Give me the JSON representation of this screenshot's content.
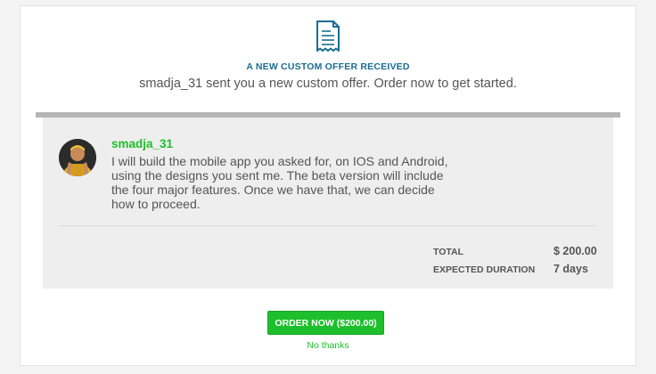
{
  "header": {
    "icon": "receipt-icon",
    "title": "A NEW CUSTOM OFFER RECEIVED",
    "subtitle": "smadja_31 sent you a new custom offer. Order now to get started."
  },
  "offer": {
    "seller_name": "smadja_31",
    "description": "I will build the mobile app you asked for, on IOS and Android, using the designs you sent me. The beta version will include the four major features. Once we have that, we can decide how to proceed.",
    "summary": [
      {
        "label": "TOTAL",
        "value": "$ 200.00"
      },
      {
        "label": "EXPECTED DURATION",
        "value": "7 days"
      }
    ]
  },
  "actions": {
    "order_label": "ORDER NOW ($200.00)",
    "decline_label": "No thanks"
  },
  "colors": {
    "accent_green": "#1dbf2a",
    "heading_blue": "#1a6d92",
    "offer_bg": "#eeeeee"
  }
}
